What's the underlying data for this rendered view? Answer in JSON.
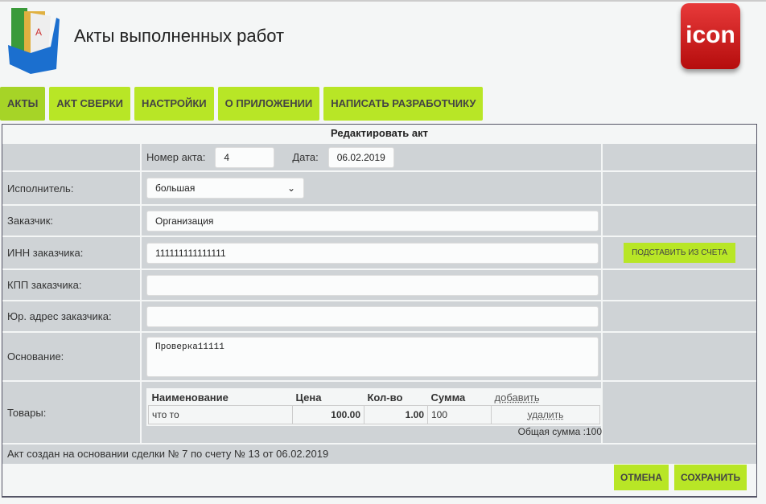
{
  "header": {
    "title": "Акты выполненных работ",
    "brand": "ICON"
  },
  "nav": [
    "АКТЫ",
    "АКТ СВЕРКИ",
    "НАСТРОЙКИ",
    "О ПРИЛОЖЕНИИ",
    "НАПИСАТЬ РАЗРАБОТЧИКУ"
  ],
  "form": {
    "title": "Редактировать акт",
    "number_label": "Номер акта:",
    "number": "4",
    "date_label": "Дата:",
    "date": "06.02.2019",
    "executor_label": "Исполнитель:",
    "executor": "большая",
    "customer_label": "Заказчик:",
    "customer": "Организация",
    "inn_label": "ИНН заказчика:",
    "inn": "111111111111111",
    "fill_button": "ПОДСТАВИТЬ ИЗ СЧЕТА",
    "kpp_label": "КПП заказчика:",
    "kpp": "",
    "address_label": "Юр. адрес заказчика:",
    "address": "",
    "basis_label": "Основание:",
    "basis": "Проверка11111",
    "goods_label": "Товары:",
    "columns": [
      "Наименование",
      "Цена",
      "Кол-во",
      "Сумма"
    ],
    "add_link": "добавить",
    "items": [
      {
        "name": "что то",
        "price": "100.00",
        "qty": "1.00",
        "sum": "100",
        "delete": "удалить"
      }
    ],
    "total": "Общая сумма :100",
    "footer": "Акт создан на основании сделки № 7 по счету № 13 от 06.02.2019"
  },
  "buttons": {
    "cancel": "ОТМЕНА",
    "save": "СОХРАНИТЬ"
  }
}
